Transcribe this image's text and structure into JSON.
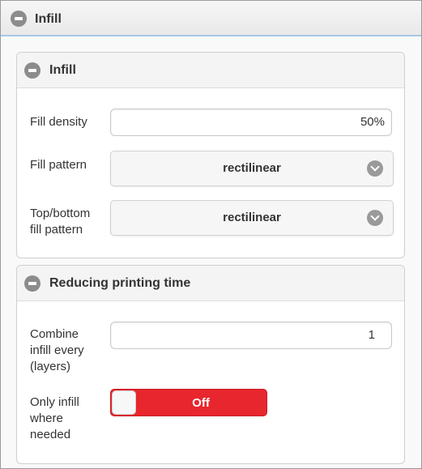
{
  "panel": {
    "title": "Infill"
  },
  "infill": {
    "title": "Infill",
    "fill_density": {
      "label": "Fill density",
      "value": "50%"
    },
    "fill_pattern": {
      "label": "Fill pattern",
      "value": "rectilinear"
    },
    "top_bottom_fill_pattern": {
      "label_line1": "Top/bottom",
      "label_line2": "fill pattern",
      "value": "rectilinear"
    }
  },
  "reducing": {
    "title": "Reducing printing time",
    "combine_infill": {
      "label_line1": "Combine",
      "label_line2": "infill every",
      "label_line3": "(layers)",
      "value": "1"
    },
    "only_infill": {
      "label_line1": "Only infill",
      "label_line2": "where",
      "label_line3": "needed",
      "toggle_label": "Off",
      "state": "off"
    }
  },
  "colors": {
    "toggle_off": "#e8262e",
    "accent_border": "#a7c9e6"
  },
  "icons": {
    "collapse": "minus-circle-icon",
    "dropdown": "chevron-down-icon"
  }
}
